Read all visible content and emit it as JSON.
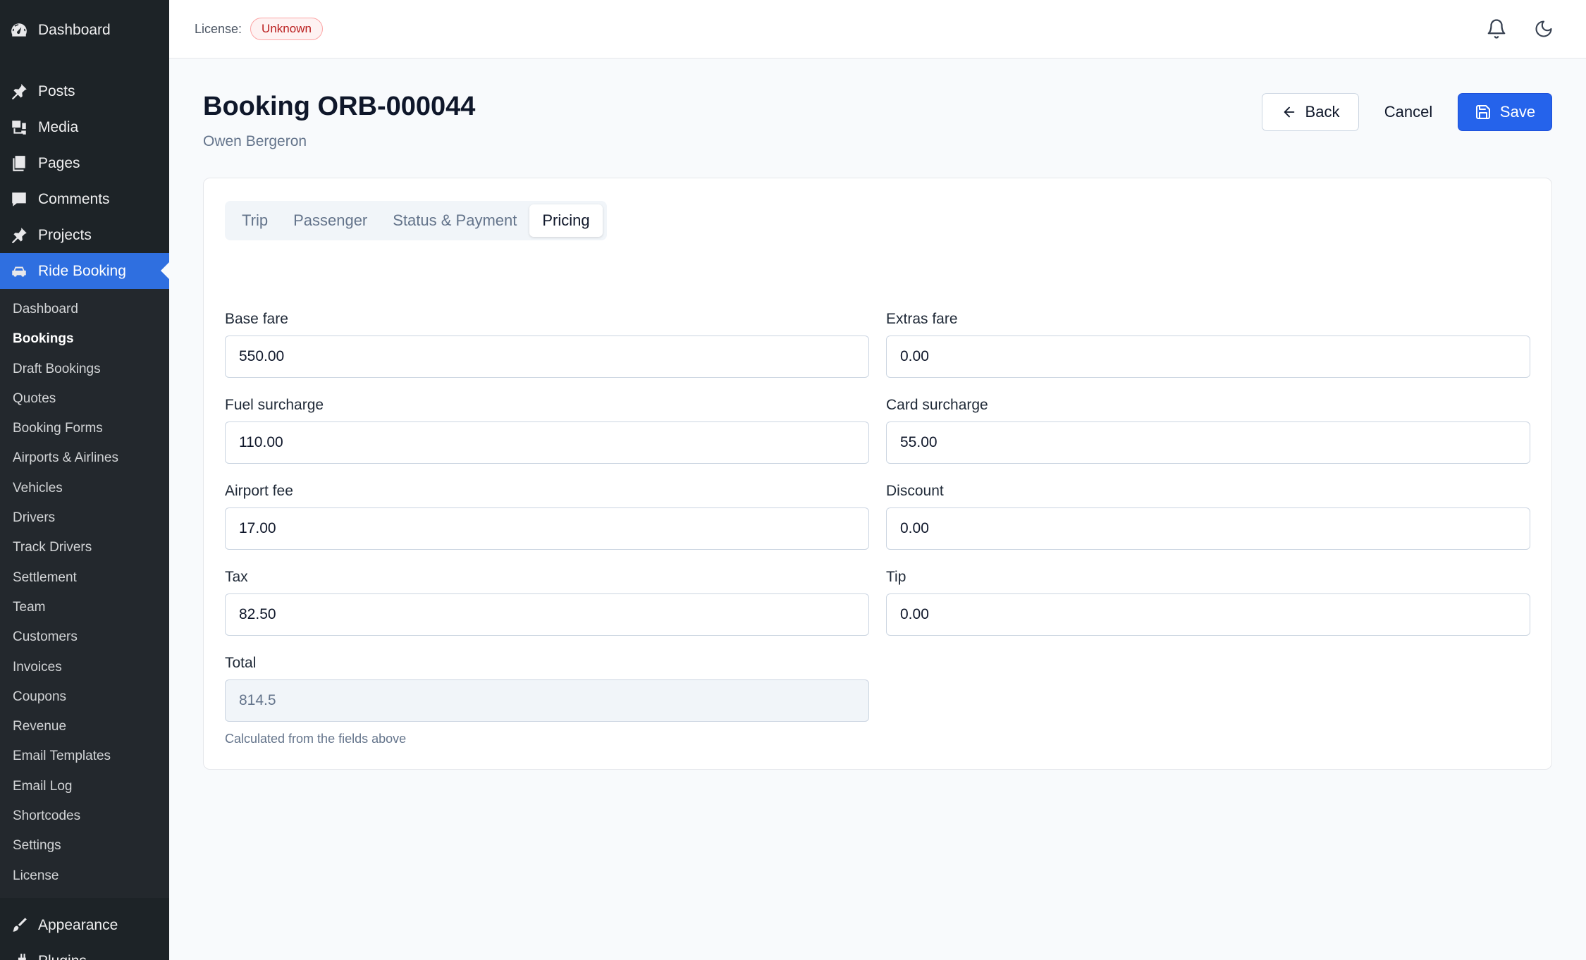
{
  "sidebar": {
    "top_items": [
      {
        "label": "Dashboard",
        "icon": "dashboard-icon"
      },
      {
        "label": "Posts",
        "icon": "pin-icon"
      },
      {
        "label": "Media",
        "icon": "media-icon"
      },
      {
        "label": "Pages",
        "icon": "pages-icon"
      },
      {
        "label": "Comments",
        "icon": "comment-icon"
      },
      {
        "label": "Projects",
        "icon": "pin-icon"
      },
      {
        "label": "Ride Booking",
        "icon": "car-icon"
      }
    ],
    "sub_items": [
      "Dashboard",
      "Bookings",
      "Draft Bookings",
      "Quotes",
      "Booking Forms",
      "Airports & Airlines",
      "Vehicles",
      "Drivers",
      "Track Drivers",
      "Settlement",
      "Team",
      "Customers",
      "Invoices",
      "Coupons",
      "Revenue",
      "Email Templates",
      "Email Log",
      "Shortcodes",
      "Settings",
      "License"
    ],
    "current_sub": "Bookings",
    "bottom_items": [
      {
        "label": "Appearance",
        "icon": "brush-icon"
      },
      {
        "label": "Plugins",
        "icon": "plugin-icon"
      }
    ]
  },
  "topbar": {
    "license_label": "License:",
    "license_status": "Unknown"
  },
  "header": {
    "title": "Booking ORB-000044",
    "subtitle": "Owen Bergeron",
    "back_label": "Back",
    "cancel_label": "Cancel",
    "save_label": "Save"
  },
  "tabs": [
    {
      "label": "Trip",
      "active": false
    },
    {
      "label": "Passenger",
      "active": false
    },
    {
      "label": "Status & Payment",
      "active": false
    },
    {
      "label": "Pricing",
      "active": true
    }
  ],
  "pricing": {
    "base_fare": {
      "label": "Base fare",
      "value": "550.00"
    },
    "extras_fare": {
      "label": "Extras fare",
      "value": "0.00"
    },
    "fuel_surcharge": {
      "label": "Fuel surcharge",
      "value": "110.00"
    },
    "card_surcharge": {
      "label": "Card surcharge",
      "value": "55.00"
    },
    "airport_fee": {
      "label": "Airport fee",
      "value": "17.00"
    },
    "discount": {
      "label": "Discount",
      "value": "0.00"
    },
    "tax": {
      "label": "Tax",
      "value": "82.50"
    },
    "tip": {
      "label": "Tip",
      "value": "0.00"
    },
    "total": {
      "label": "Total",
      "value": "814.5"
    },
    "total_hint": "Calculated from the fields above"
  },
  "colors": {
    "sidebar_bg": "#1d2327",
    "accent": "#2563eb",
    "badge_text": "#b91c1c"
  }
}
